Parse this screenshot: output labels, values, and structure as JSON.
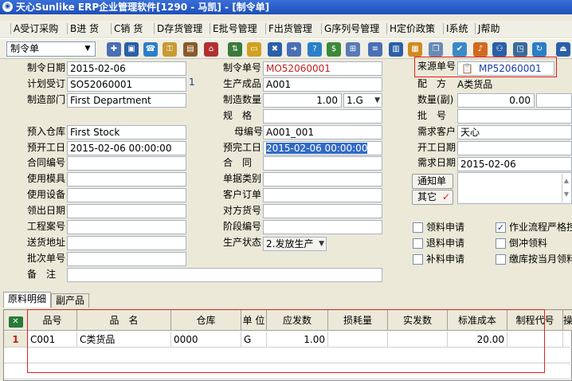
{
  "window": {
    "title": "天心Sunlike ERP企业管理软件[1290 - 马凯] - [制令单]"
  },
  "menu": [
    "A受订采购",
    "B进 货",
    "C销 货",
    "D存货管理",
    "E批号管理",
    "F出货管理",
    "G序列号管理",
    "H定价政策",
    "I系统",
    "J帮助"
  ],
  "toolbar": {
    "doc_type": "制令单"
  },
  "form": {
    "left": [
      {
        "label": "制令日期",
        "value": "2015-02-06"
      },
      {
        "label": "计划受订",
        "value": "SO52060001",
        "extra": "1"
      },
      {
        "label": "制造部门",
        "value": "First Department"
      },
      {
        "label": "预入仓库",
        "value": "First Stock"
      },
      {
        "label": "预开工日",
        "value": "2015-02-06 00:00:00"
      },
      {
        "label": "合同编号",
        "value": ""
      },
      {
        "label": "使用模具",
        "value": ""
      },
      {
        "label": "使用设备",
        "value": ""
      },
      {
        "label": "领出日期",
        "value": ""
      },
      {
        "label": "工程案号",
        "value": ""
      },
      {
        "label": "送货地址",
        "value": ""
      },
      {
        "label": "批次单号",
        "value": ""
      },
      {
        "label": "备　注",
        "value": ""
      }
    ],
    "mid": [
      {
        "label": "制令单号",
        "value": "MO52060001"
      },
      {
        "label": "生产成品",
        "value": "A001"
      },
      {
        "label": "制造数量",
        "value": "1.00",
        "unit": "1.G"
      },
      {
        "label": "规　格",
        "value": ""
      },
      {
        "label": "母编号",
        "value": "A001_001"
      },
      {
        "label": "预完工日",
        "value": "2015-02-06 00:00:00"
      },
      {
        "label": "合　同",
        "value": ""
      },
      {
        "label": "单据类别",
        "value": ""
      },
      {
        "label": "客户订单",
        "value": ""
      },
      {
        "label": "对方货号",
        "value": ""
      },
      {
        "label": "阶段编号",
        "value": ""
      },
      {
        "label": "生产状态",
        "value": "2.发放生产"
      }
    ],
    "right": [
      {
        "label": "来源单号",
        "value": "MP52060001"
      },
      {
        "label": "配　方",
        "value": "A类货品"
      },
      {
        "label": "数量(副)",
        "value": "0.00"
      },
      {
        "label": "批　号",
        "value": ""
      },
      {
        "label": "需求客户",
        "value": "天心"
      },
      {
        "label": "开工日期",
        "value": ""
      },
      {
        "label": "需求日期",
        "value": "2015-02-06"
      }
    ],
    "buttons": {
      "notify": "通知单",
      "other": "其它"
    },
    "checks": [
      {
        "label": "领料申请",
        "checked": false
      },
      {
        "label": "作业流程严格控",
        "checked": true
      },
      {
        "label": "退料申请",
        "checked": false
      },
      {
        "label": "倒冲领料",
        "checked": false
      },
      {
        "label": "补料申请",
        "checked": false
      },
      {
        "label": "缴库按当月领料",
        "checked": false
      }
    ]
  },
  "tabs": [
    "原料明细",
    "副产品"
  ],
  "grid": {
    "columns": [
      "品号",
      "品　名",
      "仓库",
      "单 位",
      "应发数",
      "损耗量",
      "实发数",
      "标准成本",
      "制程代号",
      "操"
    ],
    "rows": [
      {
        "num": "1",
        "cells": [
          "C001",
          "C类货品",
          "0000",
          "G",
          "1.00",
          "",
          "",
          "20.00",
          "",
          ""
        ]
      }
    ]
  }
}
